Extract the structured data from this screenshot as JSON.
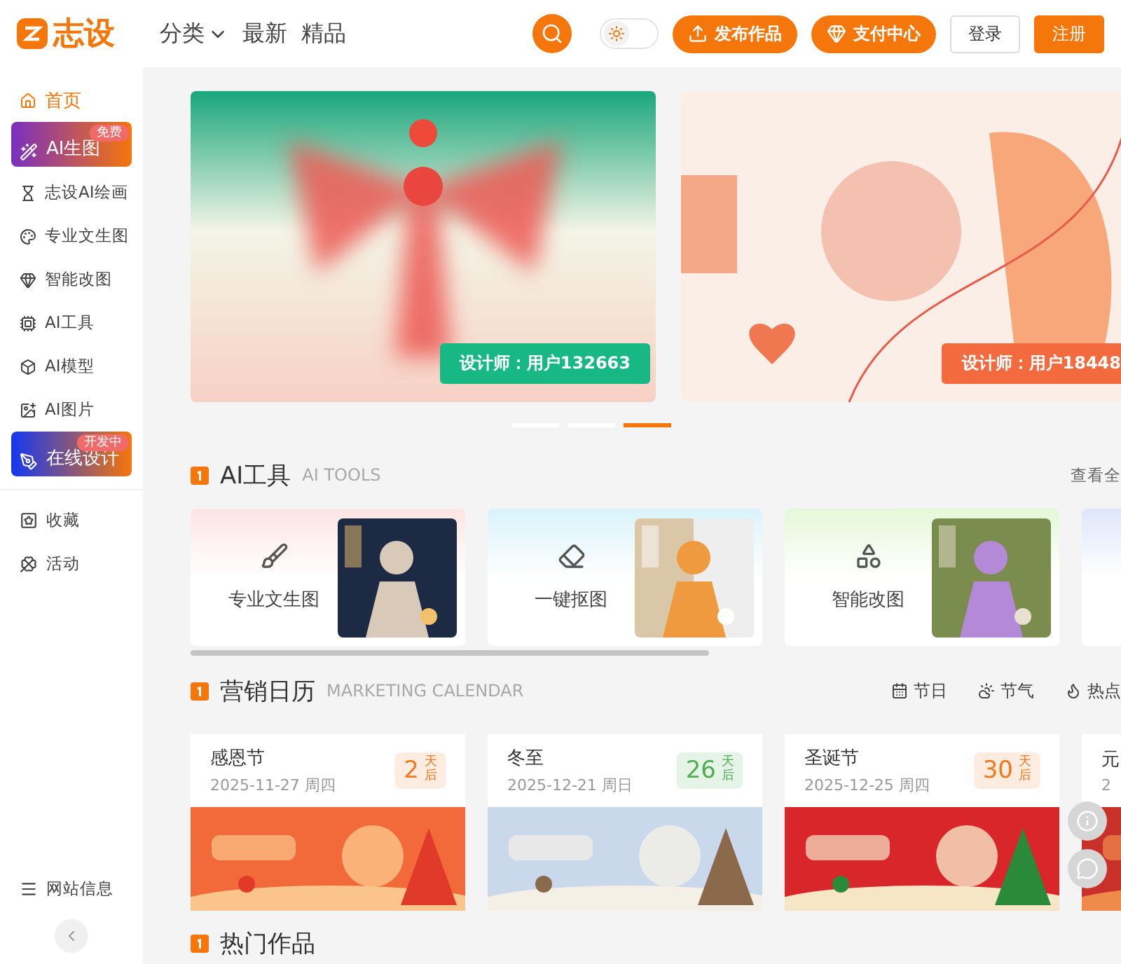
{
  "header": {
    "logo_text": "志设",
    "nav": [
      {
        "label": "分类",
        "kind": "dropdown"
      },
      {
        "label": "最新",
        "kind": "link"
      },
      {
        "label": "精品",
        "kind": "link"
      }
    ],
    "theme_toggle": {
      "on": false
    },
    "publish_button": "发布作品",
    "pay_button": "支付中心",
    "login_button": "登录",
    "register_button": "注册"
  },
  "sidebar": {
    "items": [
      {
        "label": "首页",
        "kind": "link",
        "selected": true
      },
      {
        "label": "AI生图",
        "kind": "feature",
        "selected": false,
        "badge": "免费",
        "color": "#7a2fc0"
      },
      {
        "label": "志设AI绘画",
        "kind": "link",
        "selected": false
      },
      {
        "label": "专业文生图",
        "kind": "link",
        "selected": false
      },
      {
        "label": "智能改图",
        "kind": "link",
        "selected": false
      },
      {
        "label": "AI工具",
        "kind": "link",
        "selected": false
      },
      {
        "label": "AI模型",
        "kind": "link",
        "selected": false
      },
      {
        "label": "AI图片",
        "kind": "link",
        "selected": false
      },
      {
        "label": "在线设计",
        "kind": "feature",
        "selected": false,
        "badge": "开发中",
        "color": "#1438f0"
      }
    ],
    "secondary_items": [
      {
        "label": "收藏"
      },
      {
        "label": "活动"
      }
    ],
    "site_info": "网站信息"
  },
  "banners": [
    {
      "designer": "设计师：用户132663",
      "color": "#17b884"
    },
    {
      "designer": "设计师：用户18448",
      "color": "#f26a3e"
    }
  ],
  "carousel_dots": [
    {
      "selected": false
    },
    {
      "selected": false
    },
    {
      "selected": true
    }
  ],
  "ai_tools": {
    "title": "AI工具",
    "subtitle": "AI TOOLS",
    "more": "查看全",
    "tools": [
      {
        "label": "专业文生图",
        "color": "#fde4e4"
      },
      {
        "label": "一键抠图",
        "color": "#d9f3fb"
      },
      {
        "label": "智能改图",
        "color": "#e4f8d8"
      },
      {
        "color": "#dfe6fb"
      }
    ]
  },
  "calendar": {
    "title": "营销日历",
    "subtitle": "MARKETING CALENDAR",
    "filters": [
      "节日",
      "节气",
      "热点"
    ],
    "events": [
      {
        "name": "感恩节",
        "date": "2025-11-27 周四",
        "days": "2",
        "unit": "天后",
        "color": "#f07a1c"
      },
      {
        "name": "冬至",
        "date": "2025-12-21 周日",
        "days": "26",
        "unit": "天后",
        "color": "#4caf50"
      },
      {
        "name": "圣诞节",
        "date": "2025-12-25 周四",
        "days": "30",
        "unit": "天后",
        "color": "#f07a1c"
      },
      {
        "name": "元",
        "date": "2"
      }
    ]
  },
  "hot_works": {
    "title": "热门作品"
  }
}
